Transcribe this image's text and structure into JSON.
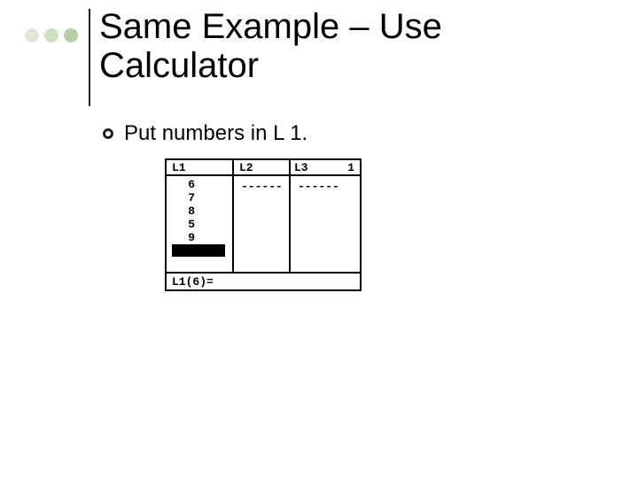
{
  "title": "Same Example – Use Calculator",
  "bullet": "Put numbers in L 1.",
  "calc": {
    "headers": {
      "c1": "L1",
      "c2": "L2",
      "c3": "L3",
      "num": "1"
    },
    "l1_values": [
      "6",
      "7",
      "8",
      "5",
      "9"
    ],
    "l2_placeholder": "------",
    "l3_placeholder": "------",
    "status": "L1(6)="
  }
}
